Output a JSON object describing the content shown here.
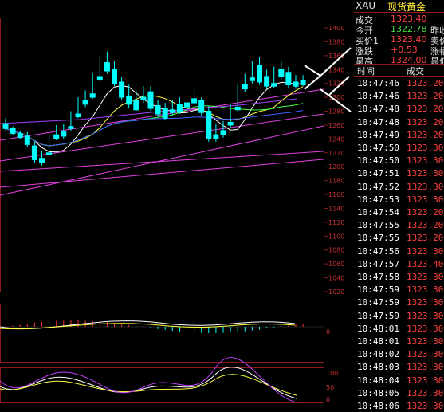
{
  "quote": {
    "symbol": "XAU",
    "name": "现货黄金",
    "rows": [
      {
        "label": "成交",
        "value": "1323.40",
        "color": "#ff4040",
        "label2": ""
      },
      {
        "label": "今开",
        "value": "1322.78",
        "color": "#40e040",
        "label2": "昨收"
      },
      {
        "label": "买价1",
        "value": "1323.40",
        "color": "#ff4040",
        "label2": "卖价"
      },
      {
        "label": "涨跌",
        "value": "+0.53",
        "color": "#ff4040",
        "label2": "涨幅"
      },
      {
        "label": "最高",
        "value": "1324.00",
        "color": "#ff4040",
        "label2": "最低"
      }
    ]
  },
  "ticks": {
    "header_time": "时间",
    "header_price": "成交",
    "rows": [
      {
        "time": "10:47:46",
        "price": "1323.20"
      },
      {
        "time": "10:47:46",
        "price": "1323.20"
      },
      {
        "time": "10:47:48",
        "price": "1323.20"
      },
      {
        "time": "10:47:48",
        "price": "1323.20"
      },
      {
        "time": "10:47:49",
        "price": "1323.20"
      },
      {
        "time": "10:47:50",
        "price": "1323.30"
      },
      {
        "time": "10:47:50",
        "price": "1323.30"
      },
      {
        "time": "10:47:51",
        "price": "1323.30"
      },
      {
        "time": "10:47:52",
        "price": "1323.30"
      },
      {
        "time": "10:47:53",
        "price": "1323.30"
      },
      {
        "time": "10:47:54",
        "price": "1323.20"
      },
      {
        "time": "10:47:55",
        "price": "1323.20"
      },
      {
        "time": "10:47:55",
        "price": "1323.20"
      },
      {
        "time": "10:47:56",
        "price": "1323.30"
      },
      {
        "time": "10:47:57",
        "price": "1323.40"
      },
      {
        "time": "10:47:58",
        "price": "1323.30"
      },
      {
        "time": "10:47:59",
        "price": "1323.30"
      },
      {
        "time": "10:47:59",
        "price": "1323.30"
      },
      {
        "time": "10:47:59",
        "price": "1323.30"
      },
      {
        "time": "10:48:01",
        "price": "1323.30"
      },
      {
        "time": "10:48:01",
        "price": "1323.30"
      },
      {
        "time": "10:48:02",
        "price": "1323.30"
      },
      {
        "time": "10:48:03",
        "price": "1323.30"
      },
      {
        "time": "10:48:04",
        "price": "1323.30"
      },
      {
        "time": "10:48:05",
        "price": "1323.30"
      },
      {
        "time": "10:48:06",
        "price": "1323.30"
      }
    ]
  },
  "chart": {
    "price_axis_labels": [
      "1400",
      "1380",
      "1360",
      "1340",
      "1320",
      "1300",
      "1280",
      "1260",
      "1240",
      "1220",
      "1200",
      "1180",
      "1160",
      "1140",
      "1120",
      "1100",
      "1080",
      "1060",
      "1040",
      "1020"
    ],
    "macd_axis_label": "0",
    "kdj_axis_labels": [
      "100",
      "50",
      "0"
    ],
    "colors": {
      "up": "#ff3030",
      "down": "#00ffff",
      "ma_white": "#ffffff",
      "ma_yellow": "#ffff40",
      "ma_green": "#40ff40",
      "ma_blue": "#4060ff",
      "trend": "#e040e0",
      "grid": "#8b1a1a"
    }
  }
}
